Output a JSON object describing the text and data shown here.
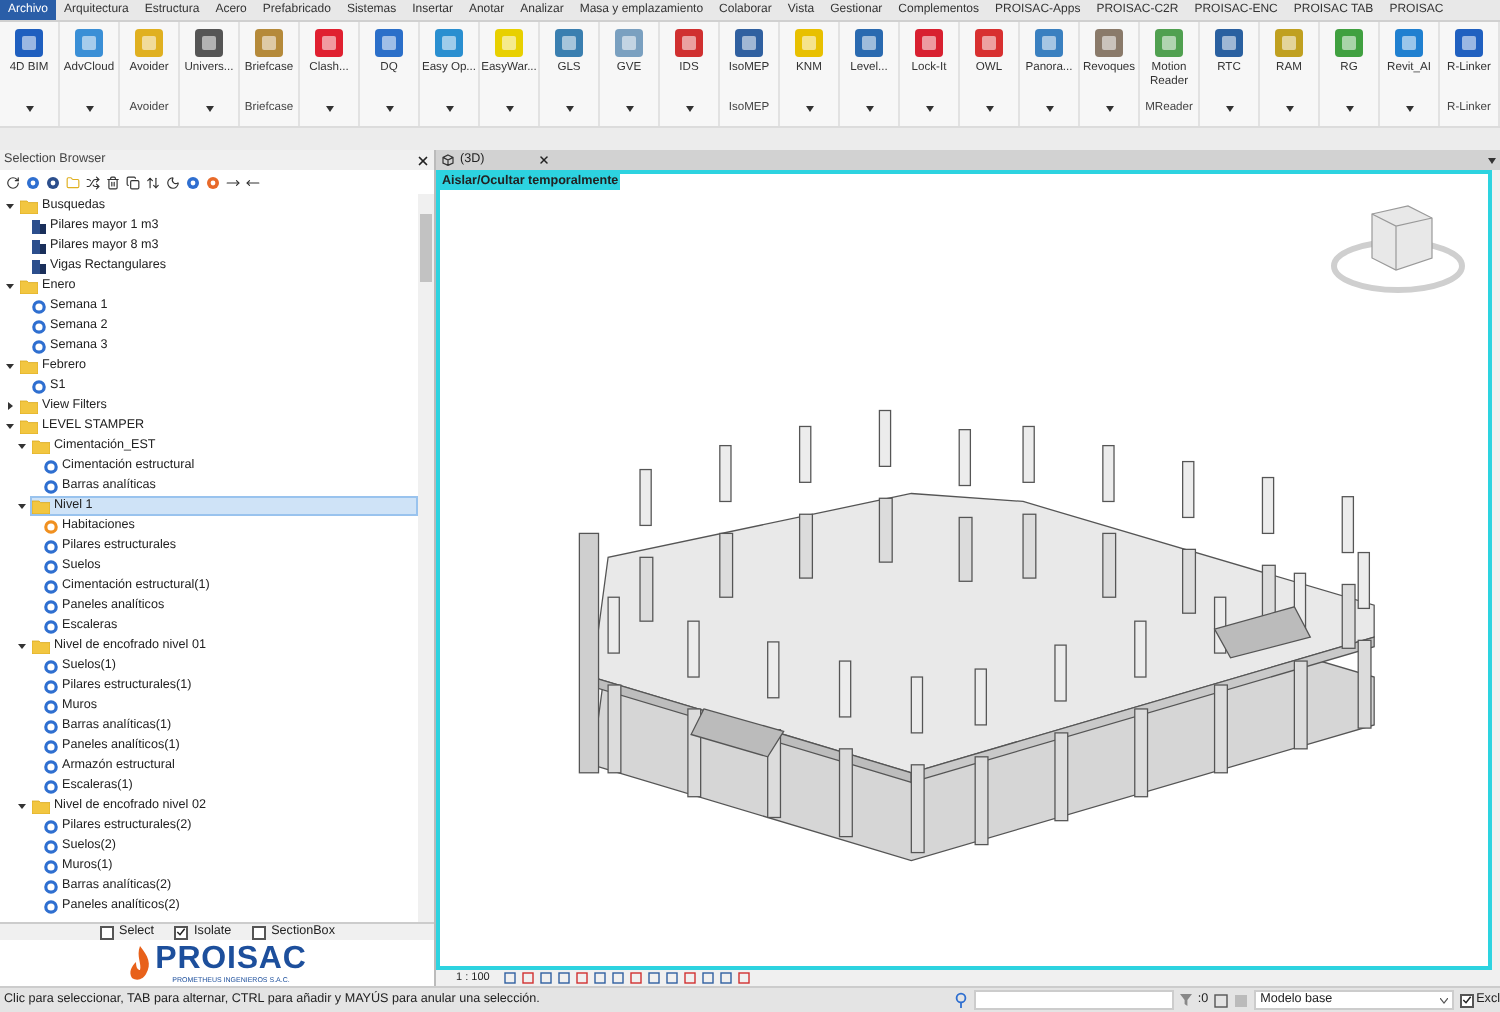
{
  "menu_tabs": [
    {
      "label": "Archivo",
      "selected": true
    },
    {
      "label": "Arquitectura",
      "selected": false
    },
    {
      "label": "Estructura",
      "selected": false
    },
    {
      "label": "Acero",
      "selected": false
    },
    {
      "label": "Prefabricado",
      "selected": false
    },
    {
      "label": "Sistemas",
      "selected": false
    },
    {
      "label": "Insertar",
      "selected": false
    },
    {
      "label": "Anotar",
      "selected": false
    },
    {
      "label": "Analizar",
      "selected": false
    },
    {
      "label": "Masa y emplazamiento",
      "selected": false
    },
    {
      "label": "Colaborar",
      "selected": false
    },
    {
      "label": "Vista",
      "selected": false
    },
    {
      "label": "Gestionar",
      "selected": false
    },
    {
      "label": "Complementos",
      "selected": false
    },
    {
      "label": "PROISAC-Apps",
      "selected": false
    },
    {
      "label": "PROISAC-C2R",
      "selected": false
    },
    {
      "label": "PROISAC-ENC",
      "selected": false
    },
    {
      "label": "PROISAC TAB",
      "selected": false
    },
    {
      "label": "PROISAC",
      "selected": false
    }
  ],
  "ribbon": [
    {
      "label": "4D BIM"
    },
    {
      "label": "AdvCloud"
    },
    {
      "label": "Avoider",
      "group": "Avoider"
    },
    {
      "label": "Univers..."
    },
    {
      "label": "Briefcase",
      "group": "Briefcase"
    },
    {
      "label": "Clash..."
    },
    {
      "label": "DQ"
    },
    {
      "label": "Easy Op..."
    },
    {
      "label": "EasyWar..."
    },
    {
      "label": "GLS"
    },
    {
      "label": "GVE"
    },
    {
      "label": "IDS"
    },
    {
      "label": "IsoMEP",
      "group": "IsoMEP"
    },
    {
      "label": "KNM"
    },
    {
      "label": "Level..."
    },
    {
      "label": "Lock-It"
    },
    {
      "label": "OWL"
    },
    {
      "label": "Panora..."
    },
    {
      "label": "Revoques"
    },
    {
      "label": "Motion Reader",
      "group": "MReader"
    },
    {
      "label": "RTC"
    },
    {
      "label": "RAM"
    },
    {
      "label": "RG"
    },
    {
      "label": "Revit_AI"
    },
    {
      "label": "R-Linker",
      "group": "R-Linker"
    }
  ],
  "selection_browser": {
    "title": "Selection Browser",
    "tree": [
      {
        "label": "Busquedas",
        "kind": "folder",
        "expanded": true,
        "selected": false,
        "children": [
          {
            "label": "Pilares mayor 1 m3",
            "kind": "saved_search",
            "selected": false
          },
          {
            "label": "Pilares mayor 8 m3",
            "kind": "saved_search",
            "selected": false
          },
          {
            "label": "Vigas Rectangulares",
            "kind": "saved_search",
            "selected": false
          }
        ]
      },
      {
        "label": "Enero",
        "kind": "folder",
        "expanded": true,
        "selected": false,
        "children": [
          {
            "label": "Semana 1",
            "kind": "filter",
            "selected": false
          },
          {
            "label": "Semana 2",
            "kind": "filter",
            "selected": false
          },
          {
            "label": "Semana 3",
            "kind": "filter",
            "selected": false
          }
        ]
      },
      {
        "label": "Febrero",
        "kind": "folder",
        "expanded": true,
        "selected": false,
        "children": [
          {
            "label": "S1",
            "kind": "filter",
            "selected": false
          }
        ]
      },
      {
        "label": "View Filters",
        "kind": "folder",
        "expanded": false,
        "selected": false
      },
      {
        "label": "LEVEL STAMPER",
        "kind": "folder",
        "expanded": true,
        "selected": false,
        "children": [
          {
            "label": "Cimentación_EST",
            "kind": "folder",
            "expanded": true,
            "selected": false,
            "children": [
              {
                "label": "Cimentación estructural",
                "kind": "filter",
                "selected": false
              },
              {
                "label": "Barras analíticas",
                "kind": "filter",
                "selected": false
              }
            ]
          },
          {
            "label": "Nivel 1",
            "kind": "folder",
            "expanded": true,
            "selected": true,
            "children": [
              {
                "label": "Habitaciones",
                "kind": "room_filter",
                "selected": false
              },
              {
                "label": "Pilares estructurales",
                "kind": "filter",
                "selected": false
              },
              {
                "label": "Suelos",
                "kind": "filter",
                "selected": false
              },
              {
                "label": "Cimentación estructural(1)",
                "kind": "filter",
                "selected": false
              },
              {
                "label": "Paneles analíticos",
                "kind": "filter",
                "selected": false
              },
              {
                "label": "Escaleras",
                "kind": "filter",
                "selected": false
              }
            ]
          },
          {
            "label": "Nivel de encofrado nivel 01",
            "kind": "folder",
            "expanded": true,
            "selected": false,
            "children": [
              {
                "label": "Suelos(1)",
                "kind": "filter",
                "selected": false
              },
              {
                "label": "Pilares estructurales(1)",
                "kind": "filter",
                "selected": false
              },
              {
                "label": "Muros",
                "kind": "filter",
                "selected": false
              },
              {
                "label": "Barras analíticas(1)",
                "kind": "filter",
                "selected": false
              },
              {
                "label": "Paneles analíticos(1)",
                "kind": "filter",
                "selected": false
              },
              {
                "label": "Armazón estructural",
                "kind": "filter",
                "selected": false
              },
              {
                "label": "Escaleras(1)",
                "kind": "filter",
                "selected": false
              }
            ]
          },
          {
            "label": "Nivel de encofrado nivel 02",
            "kind": "folder",
            "expanded": true,
            "selected": false,
            "children": [
              {
                "label": "Pilares estructurales(2)",
                "kind": "filter",
                "selected": false
              },
              {
                "label": "Suelos(2)",
                "kind": "filter",
                "selected": false
              },
              {
                "label": "Muros(1)",
                "kind": "filter",
                "selected": false
              },
              {
                "label": "Barras analíticas(2)",
                "kind": "filter",
                "selected": false
              },
              {
                "label": "Paneles analíticos(2)",
                "kind": "filter",
                "selected": false
              }
            ]
          }
        ]
      }
    ],
    "options": [
      {
        "label": "Select",
        "checked": false
      },
      {
        "label": "Isolate",
        "checked": true
      },
      {
        "label": "SectionBox",
        "checked": false
      }
    ],
    "logo": {
      "name": "PROISAC",
      "tagline": "PROMETHEUS INGENIEROS S.A.C."
    }
  },
  "view": {
    "tab": "(3D)",
    "banner": "Aislar/Ocultar temporalmente",
    "scale": "1 : 100"
  },
  "status_bar": {
    "message": "Clic para seleccionar, TAB para alternar, CTRL para añadir y MAYÚS para anular una selección.",
    "filter_count": ":0",
    "model": "Modelo base",
    "exclude": {
      "label": "Excl",
      "checked": true
    }
  }
}
